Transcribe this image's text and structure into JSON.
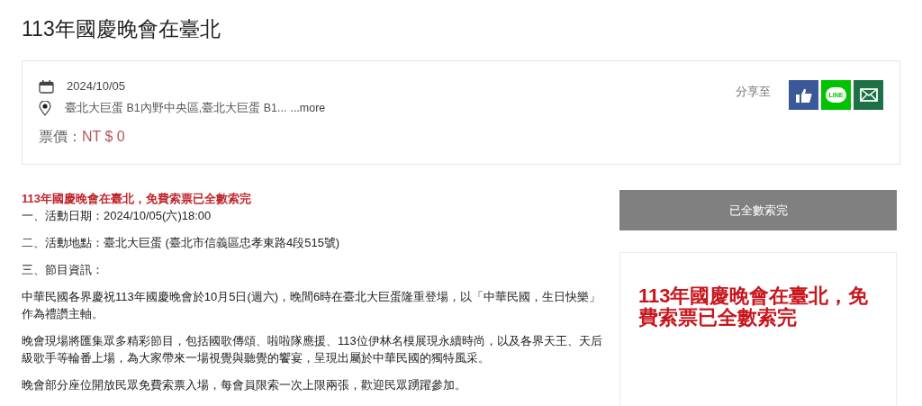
{
  "page_title": "113年國慶晚會在臺北",
  "event": {
    "date": "2024/10/05",
    "location": "臺北大巨蛋 B1內野中央區,臺北大巨蛋 B1...",
    "more_link": "...more",
    "price_label": "票價：",
    "price": "NT $ 0",
    "share_label": "分享至",
    "share_buttons": [
      {
        "kind": "facebook"
      },
      {
        "kind": "line",
        "label": "LINE"
      },
      {
        "kind": "email"
      }
    ]
  },
  "description": {
    "headline": "113年國慶晚會在臺北，免費索票已全數索完",
    "paragraphs": [
      "一、活動日期：2024/10/05(六)18:00",
      "二、活動地點：臺北大巨蛋 (臺北市信義區忠孝東路4段515號)",
      "三、節目資訊：",
      "中華民國各界慶祝113年國慶晚會於10月5日(週六)，晚間6時在臺北大巨蛋隆重登場，以「中華民國，生日快樂」作為禮讚主軸。",
      "晚會現場將匯集眾多精彩節目，包括國歌傳頌、啦啦隊應援、113位伊林名模展現永續時尚，以及各界天王、天后級歌手等輪番上場，為大家帶來一場視覺與聽覺的饗宴，呈現出屬於中華民國的獨特風采。",
      "晚會部分座位開放民眾免費索票入場，每會員限索一次上限兩張，歡迎民眾踴躍參加。"
    ]
  },
  "ticket_button": {
    "label": "已全數索完",
    "disabled": true
  },
  "notice": "113年國慶晚會在臺北，免費索票已全數索完"
}
